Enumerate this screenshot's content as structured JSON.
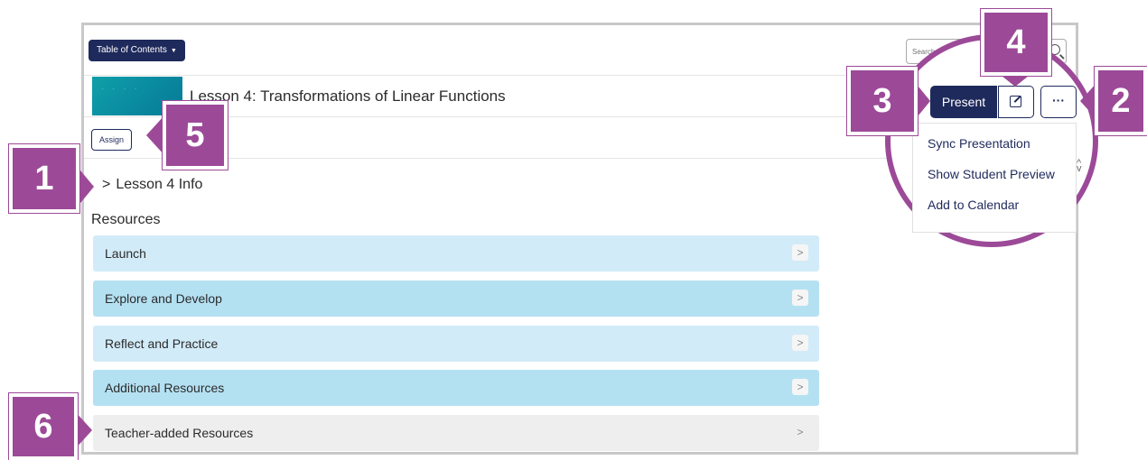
{
  "toolbar": {
    "toc_label": "Table of Contents",
    "search_placeholder": "Search Course"
  },
  "lesson": {
    "title": "Lesson 4: Transformations of Linear Functions",
    "assign_label": "Assign",
    "info_label": "Lesson 4 Info",
    "resources_heading": "Resources"
  },
  "resources": [
    {
      "label": "Launch"
    },
    {
      "label": "Explore and Develop"
    },
    {
      "label": "Reflect and Practice"
    },
    {
      "label": "Additional Resources"
    },
    {
      "label": "Teacher-added Resources"
    }
  ],
  "actions": {
    "present_label": "Present",
    "more_label": "···"
  },
  "more_menu": [
    {
      "label": "Sync Presentation"
    },
    {
      "label": "Show Student Preview"
    },
    {
      "label": "Add to Calendar"
    }
  ],
  "callouts": {
    "c1": "1",
    "c2": "2",
    "c3": "3",
    "c4": "4",
    "c5": "5",
    "c6": "6"
  },
  "colors": {
    "navy": "#1f2a5c",
    "callout_purple": "#9c4a98",
    "resource_light": "#d2ebf8",
    "resource_dark": "#b4e1f2",
    "resource_grey": "#eeeeee"
  }
}
